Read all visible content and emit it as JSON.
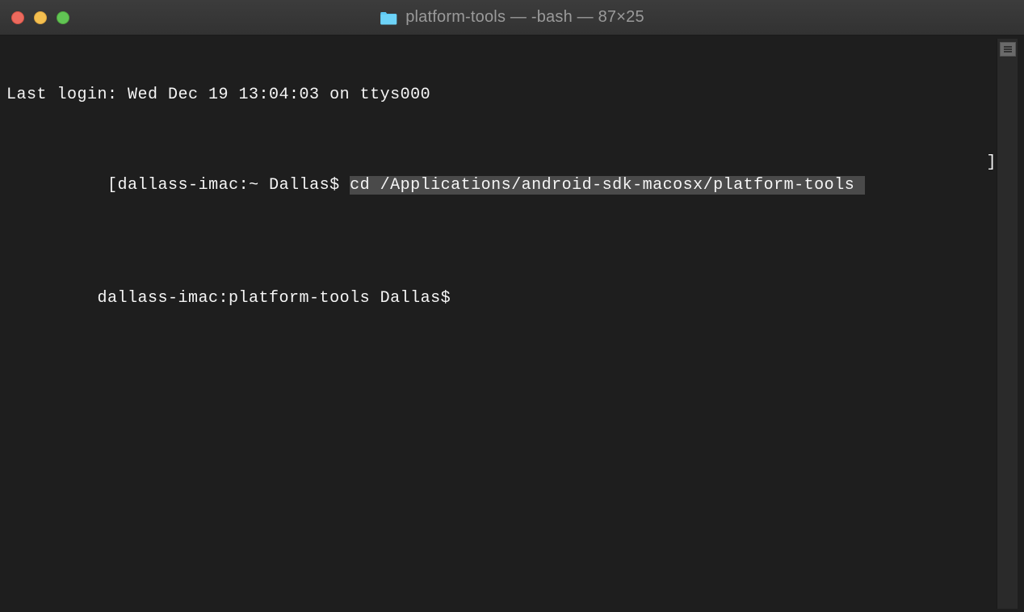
{
  "window": {
    "title": "platform-tools — -bash — 87×25"
  },
  "terminal": {
    "lastLogin": "Last login: Wed Dec 19 13:04:03 on ttys000",
    "line1": {
      "bracketOpen": "[",
      "prompt": "dallass-imac:~ Dallas$ ",
      "command": "cd /Applications/android-sdk-macosx/platform-tools ",
      "bracketClose": "]"
    },
    "line2": {
      "prompt": " dallass-imac:platform-tools Dallas$ "
    }
  }
}
